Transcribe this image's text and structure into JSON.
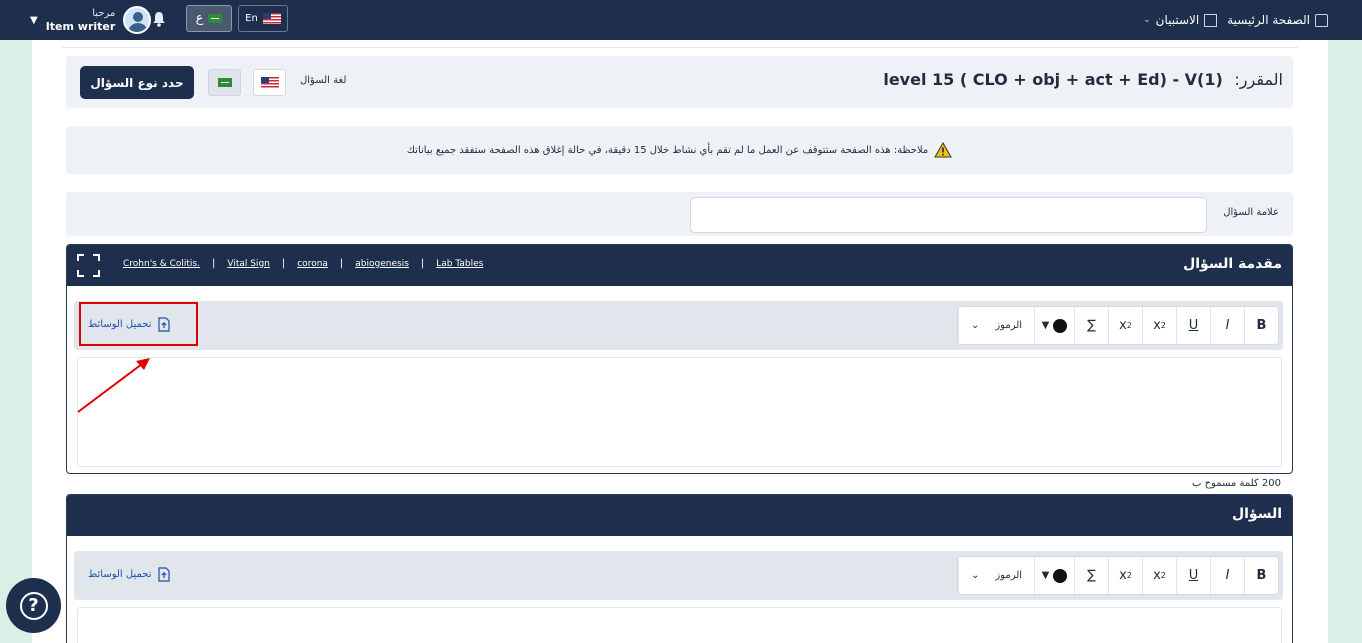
{
  "topbar": {
    "greeting": "مرحبا",
    "role": "Item writer",
    "lang_ar": "ع",
    "lang_en": "En",
    "nav_home": "الصفحة الرئيسية",
    "nav_survey": "الاستبيان"
  },
  "header": {
    "course_label": "المقرر:",
    "course_name": "level 15 ( CLO + obj + act + Ed) - V(1)",
    "question_lang_label": "لغة السؤال",
    "select_type_button": "حدد نوع السؤال"
  },
  "note": {
    "text": "ملاحظة: هذه الصفحة ستتوقف عن العمل ما لم تقم بأي نشاط خلال 15 دقيقة، في حالة إغلاق هذه الصفحة ستفقد جميع بياناتك"
  },
  "mark": {
    "label": "علامة السؤال",
    "value": ""
  },
  "intro_section": {
    "title": "مقدمة السؤال",
    "tags": [
      "Crohn's & Colitis.",
      "Vital Sign",
      "corona",
      "abiogenesis",
      "Lab Tables"
    ],
    "upload_label": "تحميل الوسائط",
    "word_limit": "200 كلمة مسموح ب"
  },
  "question_section": {
    "title": "السؤال",
    "upload_label": "تحميل الوسائط"
  },
  "toolbar": {
    "bold": "B",
    "italic": "I",
    "underline": "U",
    "subscript": "x",
    "superscript": "x",
    "sub_mark": "2",
    "sup_mark": "2",
    "sum": "∑",
    "color_caret": "▼",
    "symbols": "الرموز",
    "symbols_chevron": "⌄"
  },
  "help": {
    "icon": "?"
  },
  "colors": {
    "navy": "#1e2f4d",
    "highlight": "#e00000",
    "link": "#1e4fa3"
  }
}
